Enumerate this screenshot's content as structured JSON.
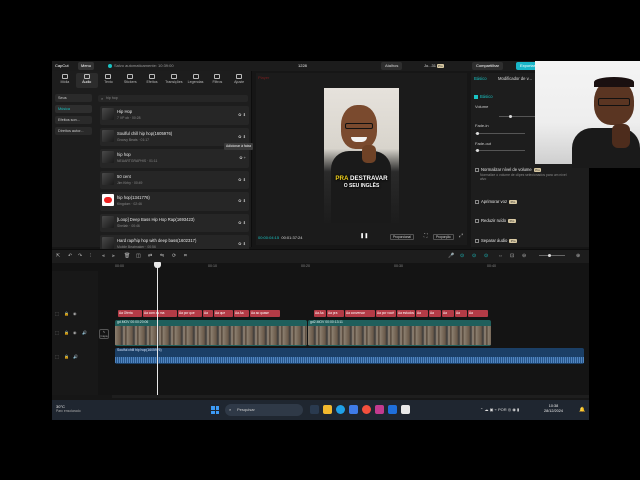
{
  "titlebar": {
    "app": "CapCut",
    "menu": "Menu",
    "saved": "Salvo automaticamente: 10:39:00",
    "project": "1228",
    "shortcuts": "Atalhos",
    "user": "Jo...31",
    "pro": "Pro",
    "share": "Compartilhar",
    "export": "Exportar"
  },
  "tabs": [
    {
      "label": "Mídia",
      "icon": "media-icon"
    },
    {
      "label": "Áudio",
      "icon": "audio-icon"
    },
    {
      "label": "Texto",
      "icon": "text-icon"
    },
    {
      "label": "Stickers",
      "icon": "sticker-icon"
    },
    {
      "label": "Efeitos",
      "icon": "effects-icon"
    },
    {
      "label": "Transições",
      "icon": "transitions-icon"
    },
    {
      "label": "Legendas",
      "icon": "captions-icon"
    },
    {
      "label": "Filtros",
      "icon": "filters-icon"
    },
    {
      "label": "Ajuste",
      "icon": "adjust-icon"
    }
  ],
  "side": [
    "Seus",
    "Música",
    "Efeitos son...",
    "Direitos autor..."
  ],
  "search_placeholder": "hip hop",
  "tracks": [
    {
      "title": "Hip Hop",
      "sub": "7 VP ob · 00:28"
    },
    {
      "title": "Soulful chill hip hop(1605976)",
      "sub": "Groovy Beats · 01:17"
    },
    {
      "title": "hip hop",
      "sub": "NEUARTGRAPHIS · 01:11"
    },
    {
      "title": "50 cent",
      "sub": "Jim Kirby · 00:49"
    },
    {
      "title": "hip hop(1341776)",
      "sub": "Kingdom · 02:46"
    },
    {
      "title": "[Loop] Deep Bass Hip Hop Rap(1693423)",
      "sub": "Sheilah · 00:46"
    },
    {
      "title": "Hard rap/hip hop with deep bass(1602317)",
      "sub": "Mobile Beatmaker · 00:56"
    }
  ],
  "tooltip": "Adicionar à faixa",
  "player": {
    "header": "Player",
    "caption_highlight": "PRA",
    "caption_rest": " DESTRAVAR",
    "caption_line2": "O SEU INGLÊS",
    "current": "00:00:04:15",
    "total": "00:01:37:24",
    "ratio": "Proporcional",
    "full": "Proporção"
  },
  "right": {
    "tab1": "Básico",
    "tab2": "Modificador de v...",
    "basic": "Básico",
    "volume": "Volume",
    "fadein": "Fade-in",
    "fadeout": "Fade-out",
    "normalize": "Normalizar nível de volume",
    "normalize_sub": "Normalize o volume de clipes selecionados para um nível alvo",
    "enhance": "Aprimorar voz",
    "noise": "Reduzir ruído",
    "split": "Separar áudio",
    "pro": "Pro"
  },
  "timeline": {
    "ruler": [
      "00:00",
      "00:10",
      "00:20",
      "00:30",
      "00:40"
    ],
    "cover": "Capa",
    "captions": [
      "Aa Oferta",
      "Aa com as ma",
      "Aa por que",
      "Aa",
      "Aa que",
      "Aa Aa",
      "Aa ao quase",
      "Aa Aa",
      "Aa pra",
      "Aa conversar",
      "Aa por você",
      "Aa estudos",
      "Aa",
      "Aa",
      "Aa",
      "Aa",
      "Aa"
    ],
    "video1": "gd.MOV  00:00:20:06",
    "video2": "gd2.MOV  00:00:13:11",
    "audio": "Soulful chill hip hop(1605976)"
  },
  "taskbar": {
    "temp": "30°C",
    "weather": "Parc ensolarado",
    "search": "Pesquisar",
    "lang": "POR",
    "time": "10:38",
    "date": "28/12/2024"
  }
}
